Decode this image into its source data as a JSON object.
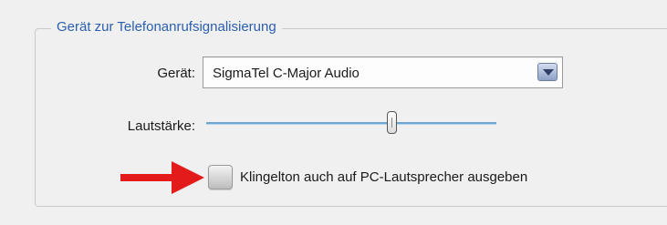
{
  "group": {
    "legend": "Gerät zur Telefonanrufsignalisierung"
  },
  "device": {
    "label": "Gerät:",
    "selected": "SigmaTel C-Major Audio"
  },
  "volume": {
    "label": "Lautstärke:",
    "level": 0.64
  },
  "ringtone": {
    "label": "Klingelton auch auf PC-Lautsprecher ausgeben",
    "checked": false
  },
  "annotation": {
    "arrow_icon": "red-arrow-right-icon",
    "arrow_color": "#e31b1b"
  },
  "colors": {
    "legend": "#2a5fb0",
    "slider_track": "#6ea6cf",
    "combo_button": "#8fa1c7"
  }
}
